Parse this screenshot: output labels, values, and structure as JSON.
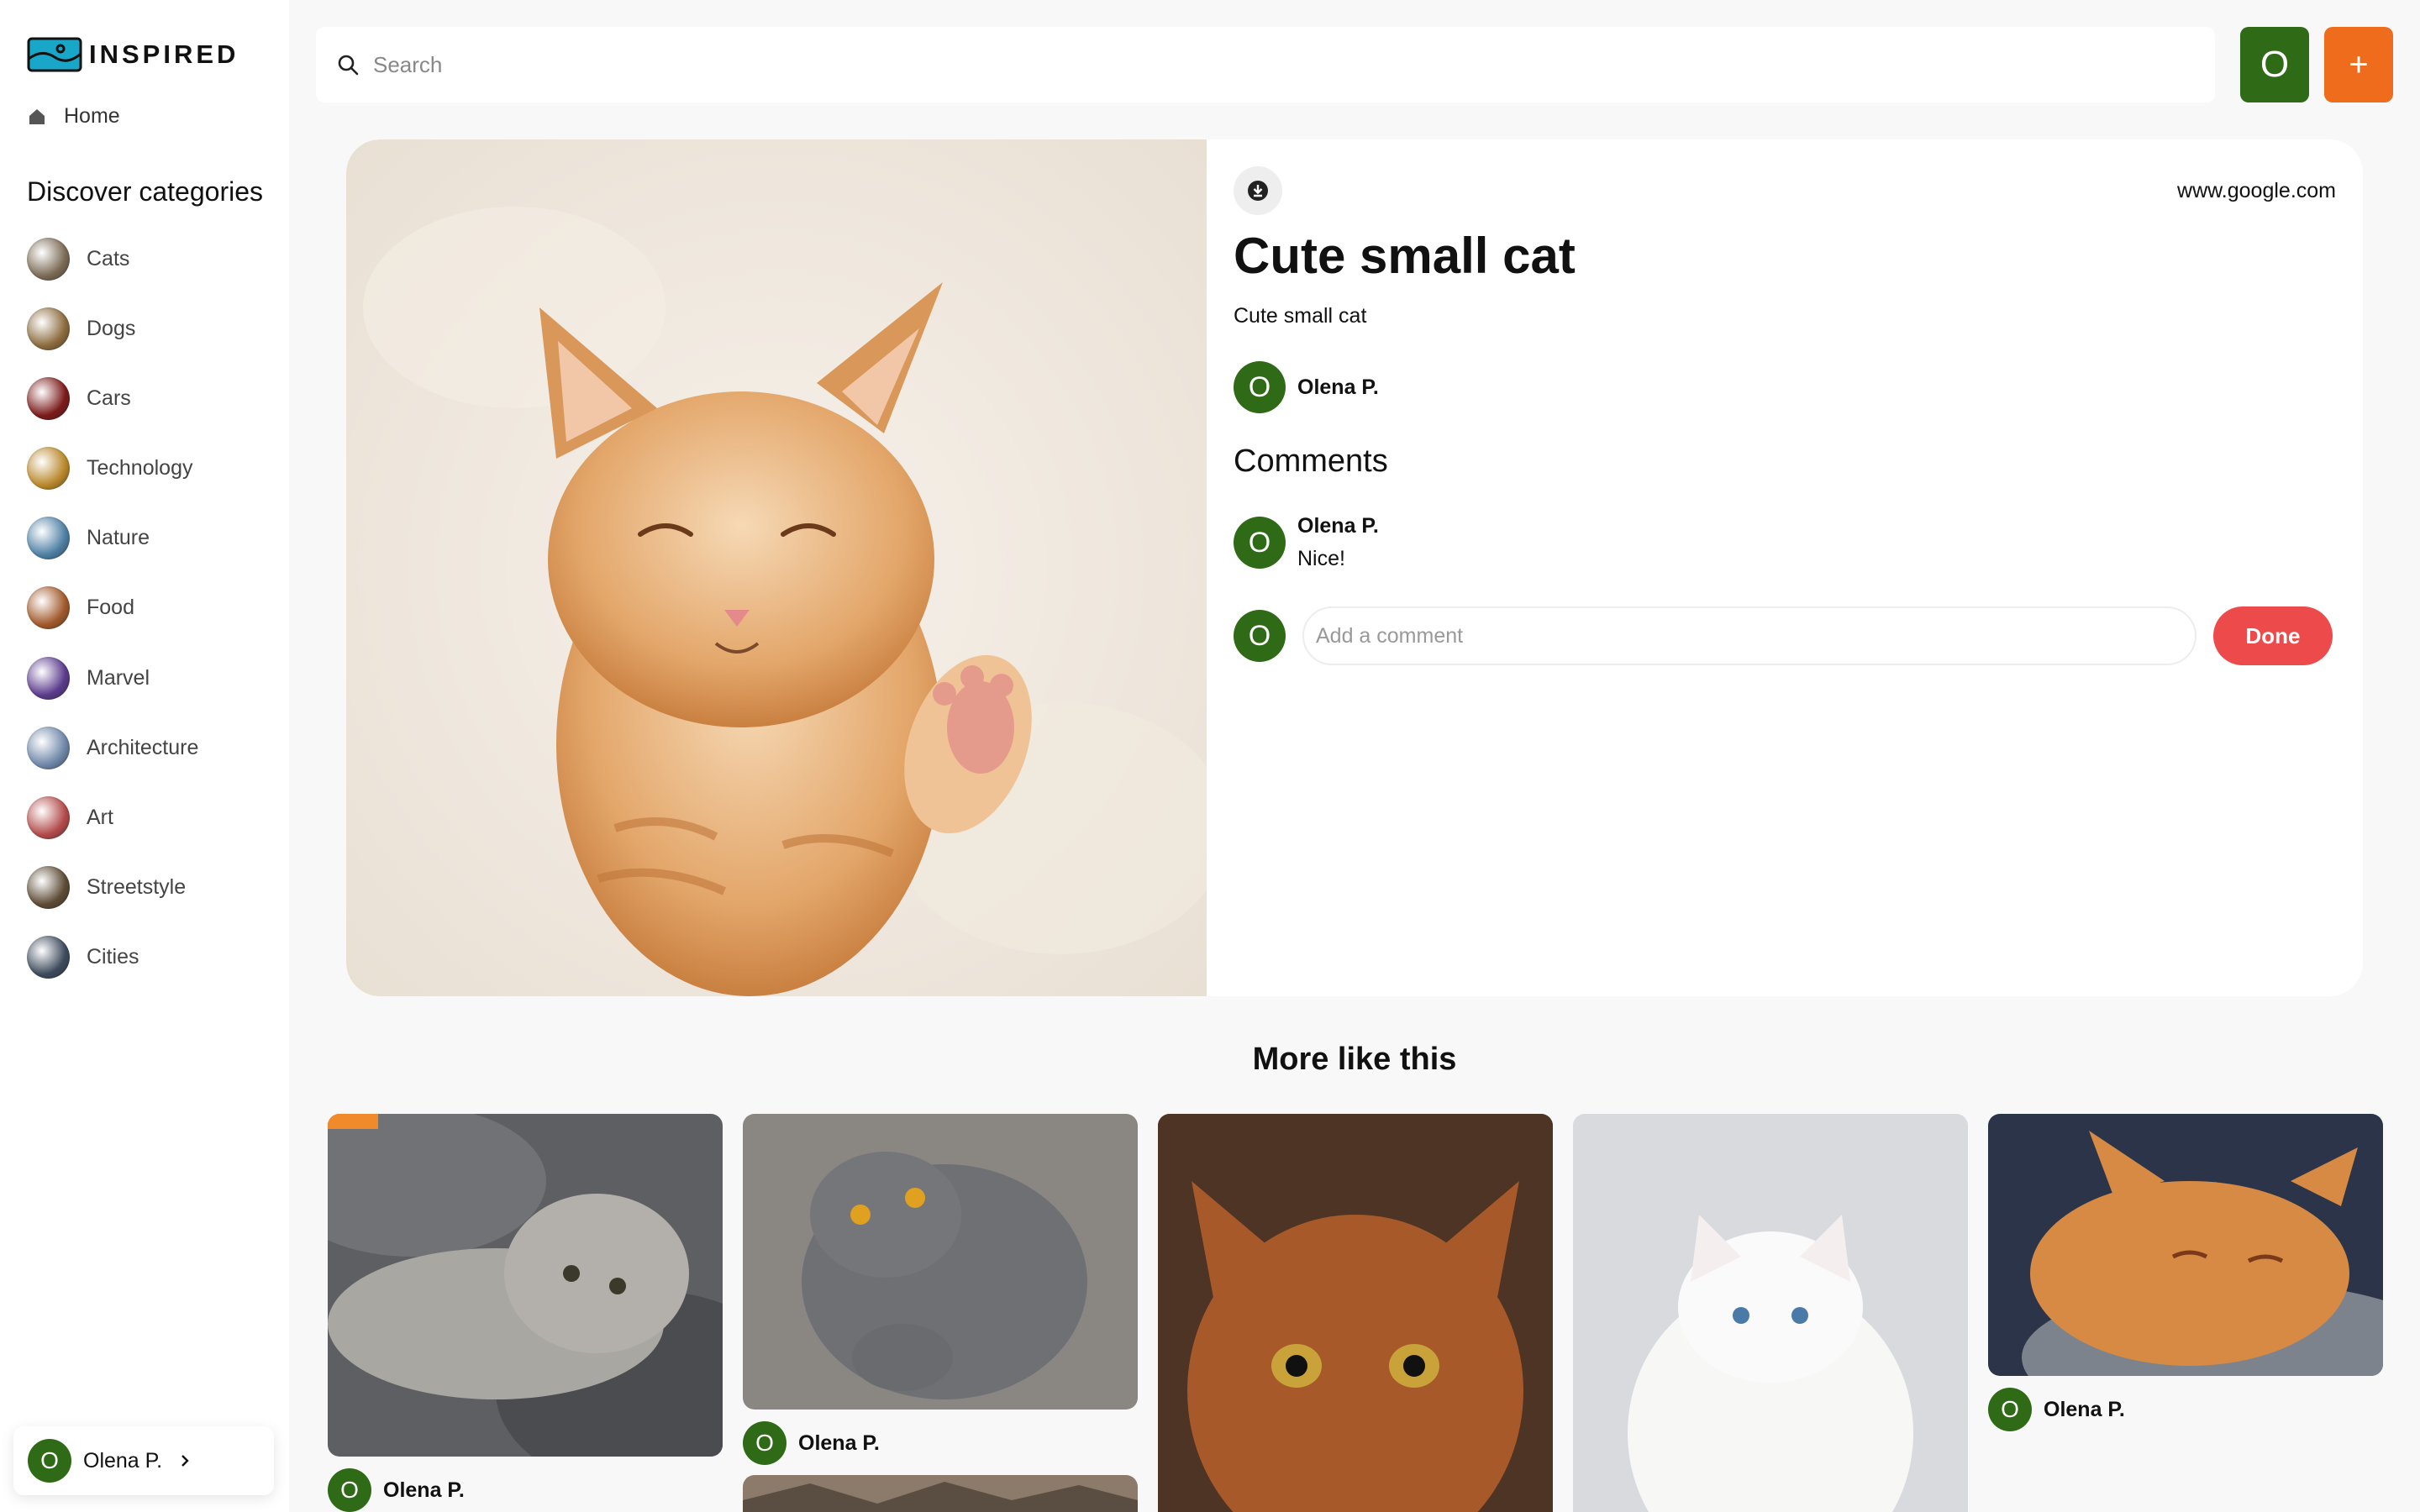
{
  "app": {
    "brand": "INSPIRED",
    "nav_home": "Home",
    "categories_heading": "Discover categories",
    "categories": [
      {
        "label": "Cats",
        "color": "#7a6a55"
      },
      {
        "label": "Dogs",
        "color": "#8b6a3c"
      },
      {
        "label": "Cars",
        "color": "#7b1a1a"
      },
      {
        "label": "Technology",
        "color": "#b8872a"
      },
      {
        "label": "Nature",
        "color": "#4d7fa3"
      },
      {
        "label": "Food",
        "color": "#a0582a"
      },
      {
        "label": "Marvel",
        "color": "#5a3a8c"
      },
      {
        "label": "Architecture",
        "color": "#6e86a8"
      },
      {
        "label": "Art",
        "color": "#b24a4a"
      },
      {
        "label": "Streetstyle",
        "color": "#5c4a34"
      },
      {
        "label": "Cities",
        "color": "#3d4a5c"
      }
    ]
  },
  "user": {
    "initial": "O",
    "name": "Olena P."
  },
  "search": {
    "placeholder": "Search"
  },
  "topbar": {
    "user_initial": "O",
    "add_label": "+"
  },
  "pin": {
    "source": "www.google.com",
    "title": "Cute small cat",
    "description": "Cute small cat",
    "author_initial": "O",
    "author": "Olena P.",
    "comments_heading": "Comments",
    "comments": [
      {
        "initial": "O",
        "author": "Olena P.",
        "text": "Nice!"
      }
    ],
    "comment_placeholder": "Add a comment",
    "done_label": "Done"
  },
  "more": {
    "heading": "More like this",
    "items": [
      {
        "author_initial": "O",
        "author": "Olena P.",
        "palette": "#9a9a96"
      },
      {
        "author_initial": "O",
        "author": "Olena P.",
        "palette": "#7f8082"
      },
      {
        "author_initial": "",
        "author": "",
        "palette": "#8a4a25"
      },
      {
        "author_initial": "",
        "author": "",
        "palette": "#e6e7ea"
      },
      {
        "author_initial": "O",
        "author": "Olena P.",
        "palette": "#d68a44"
      },
      {
        "author_initial": "",
        "author": "",
        "palette": "#8c7a6a"
      }
    ]
  },
  "colors": {
    "accent_green": "#2f6a17",
    "accent_orange": "#f06c1d",
    "done_red": "#ed4b4b"
  }
}
